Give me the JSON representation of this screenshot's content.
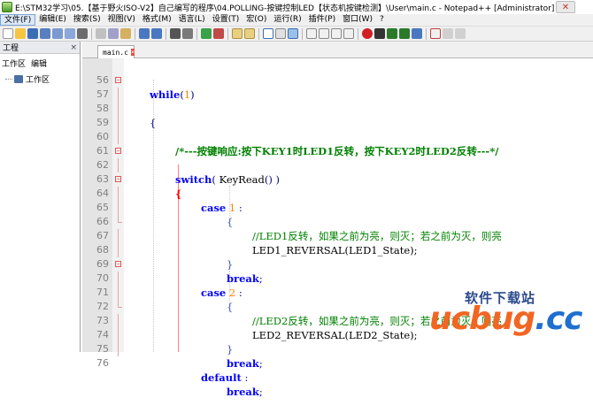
{
  "window": {
    "title": "E:\\STM32学习\\05.【基于野火ISO-V2】自己编写的程序\\04.POLLING-按键控制LED【状态机按键检测】\\User\\main.c - Notepad++ [Administrator]",
    "close_glyph": "✕"
  },
  "menu": [
    "文件(F)",
    "编辑(E)",
    "搜索(S)",
    "视图(V)",
    "格式(M)",
    "语言(L)",
    "设置(T)",
    "宏(O)",
    "运行(R)",
    "插件(P)",
    "窗口(W)",
    "?"
  ],
  "left_panel": {
    "title": "工程",
    "close": "×",
    "menu": [
      "工作区",
      "编辑"
    ],
    "tree_item": "工作区"
  },
  "tab": {
    "label": "main.c"
  },
  "code_lines": [
    {
      "n": "56",
      "text": "while(1)"
    },
    {
      "n": "57",
      "text": "{"
    },
    {
      "n": "58",
      "text": ""
    },
    {
      "n": "59",
      "text": "/*---按键响应:按下KEY1时LED1反转，按下KEY2时LED2反转---*/"
    },
    {
      "n": "60",
      "text": ""
    },
    {
      "n": "61",
      "text": "switch( KeyRead() )"
    },
    {
      "n": "62",
      "text": "{"
    },
    {
      "n": "63",
      "text": "case 1 :"
    },
    {
      "n": "64",
      "text": "{"
    },
    {
      "n": "65",
      "text": "//LED1反转，如果之前为亮，则灭；若之前为灭，则亮"
    },
    {
      "n": "66",
      "text": "LED1_REVERSAL(LED1_State);"
    },
    {
      "n": "67",
      "text": "}"
    },
    {
      "n": "68",
      "text": "break;"
    },
    {
      "n": "69",
      "text": "case 2 :"
    },
    {
      "n": "70",
      "text": "{"
    },
    {
      "n": "71",
      "text": "//LED2反转，如果之前为亮，则灭；若之前为灭，则亮"
    },
    {
      "n": "72",
      "text": "LED2_REVERSAL(LED2_State);"
    },
    {
      "n": "73",
      "text": "}"
    },
    {
      "n": "74",
      "text": "break;"
    },
    {
      "n": "75",
      "text": "default :"
    },
    {
      "n": "76",
      "text": "break;"
    }
  ],
  "watermark": {
    "top": "软件下载站",
    "main": "ucbug",
    "suffix": ".cc"
  },
  "colors": {
    "keyword": "#0000ff",
    "number": "#ff8000",
    "comment": "#008000",
    "brace_highlight": "#ff0000"
  }
}
